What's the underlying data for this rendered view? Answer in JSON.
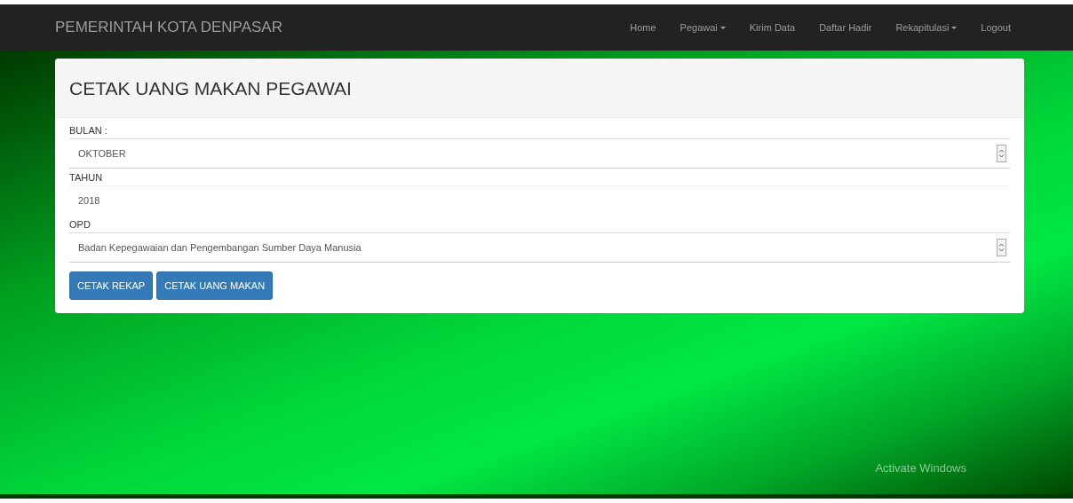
{
  "navbar": {
    "brand": "PEMERINTAH KOTA DENPASAR",
    "items": [
      {
        "label": "Home",
        "dropdown": false
      },
      {
        "label": "Pegawai",
        "dropdown": true
      },
      {
        "label": "Kirim Data",
        "dropdown": false
      },
      {
        "label": "Daftar Hadir",
        "dropdown": false
      },
      {
        "label": "Rekapitulasi",
        "dropdown": true
      },
      {
        "label": "Logout",
        "dropdown": false
      }
    ]
  },
  "panel": {
    "title": "CETAK UANG MAKAN PEGAWAI",
    "fields": [
      {
        "label": "BULAN :",
        "kind": "select",
        "value": "OKTOBER"
      },
      {
        "label": "TAHUN",
        "kind": "input",
        "value": "2018"
      },
      {
        "label": "OPD",
        "kind": "select",
        "value": "Badan Kepegawaian dan Pengembangan Sumber Daya Manusia"
      }
    ],
    "buttons": [
      "CETAK REKAP",
      "CETAK UANG MAKAN"
    ]
  },
  "os_notice": "Activate Windows"
}
